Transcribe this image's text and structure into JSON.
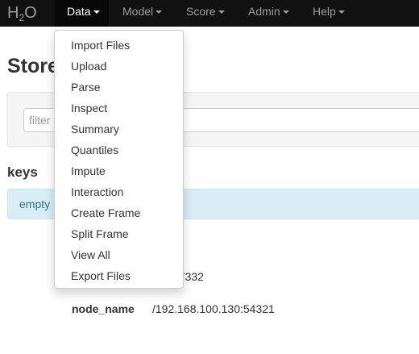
{
  "navbar": {
    "brand_main": "H",
    "brand_sub": "2",
    "brand_tail": "O",
    "items": [
      {
        "label": "Data"
      },
      {
        "label": "Model"
      },
      {
        "label": "Score"
      },
      {
        "label": "Admin"
      },
      {
        "label": "Help"
      }
    ]
  },
  "page": {
    "title": "Store",
    "filter_placeholder": "filter",
    "keys_heading": "keys",
    "keys_empty": "empty",
    "partial_value": "77332",
    "node_name_label": "node_name",
    "node_name_value": "/192.168.100.130:54321"
  },
  "data_menu": {
    "items": [
      {
        "label": "Import Files"
      },
      {
        "label": "Upload"
      },
      {
        "label": "Parse"
      },
      {
        "label": "Inspect"
      },
      {
        "label": "Summary"
      },
      {
        "label": "Quantiles"
      },
      {
        "label": "Impute"
      },
      {
        "label": "Interaction"
      },
      {
        "label": "Create Frame"
      },
      {
        "label": "Split Frame"
      },
      {
        "label": "View All"
      },
      {
        "label": "Export Files"
      }
    ]
  },
  "colors": {
    "navbar_bg": "#111111",
    "active_nav_bg": "#080808",
    "info_bg": "#d9edf7",
    "info_text": "#31708f"
  }
}
